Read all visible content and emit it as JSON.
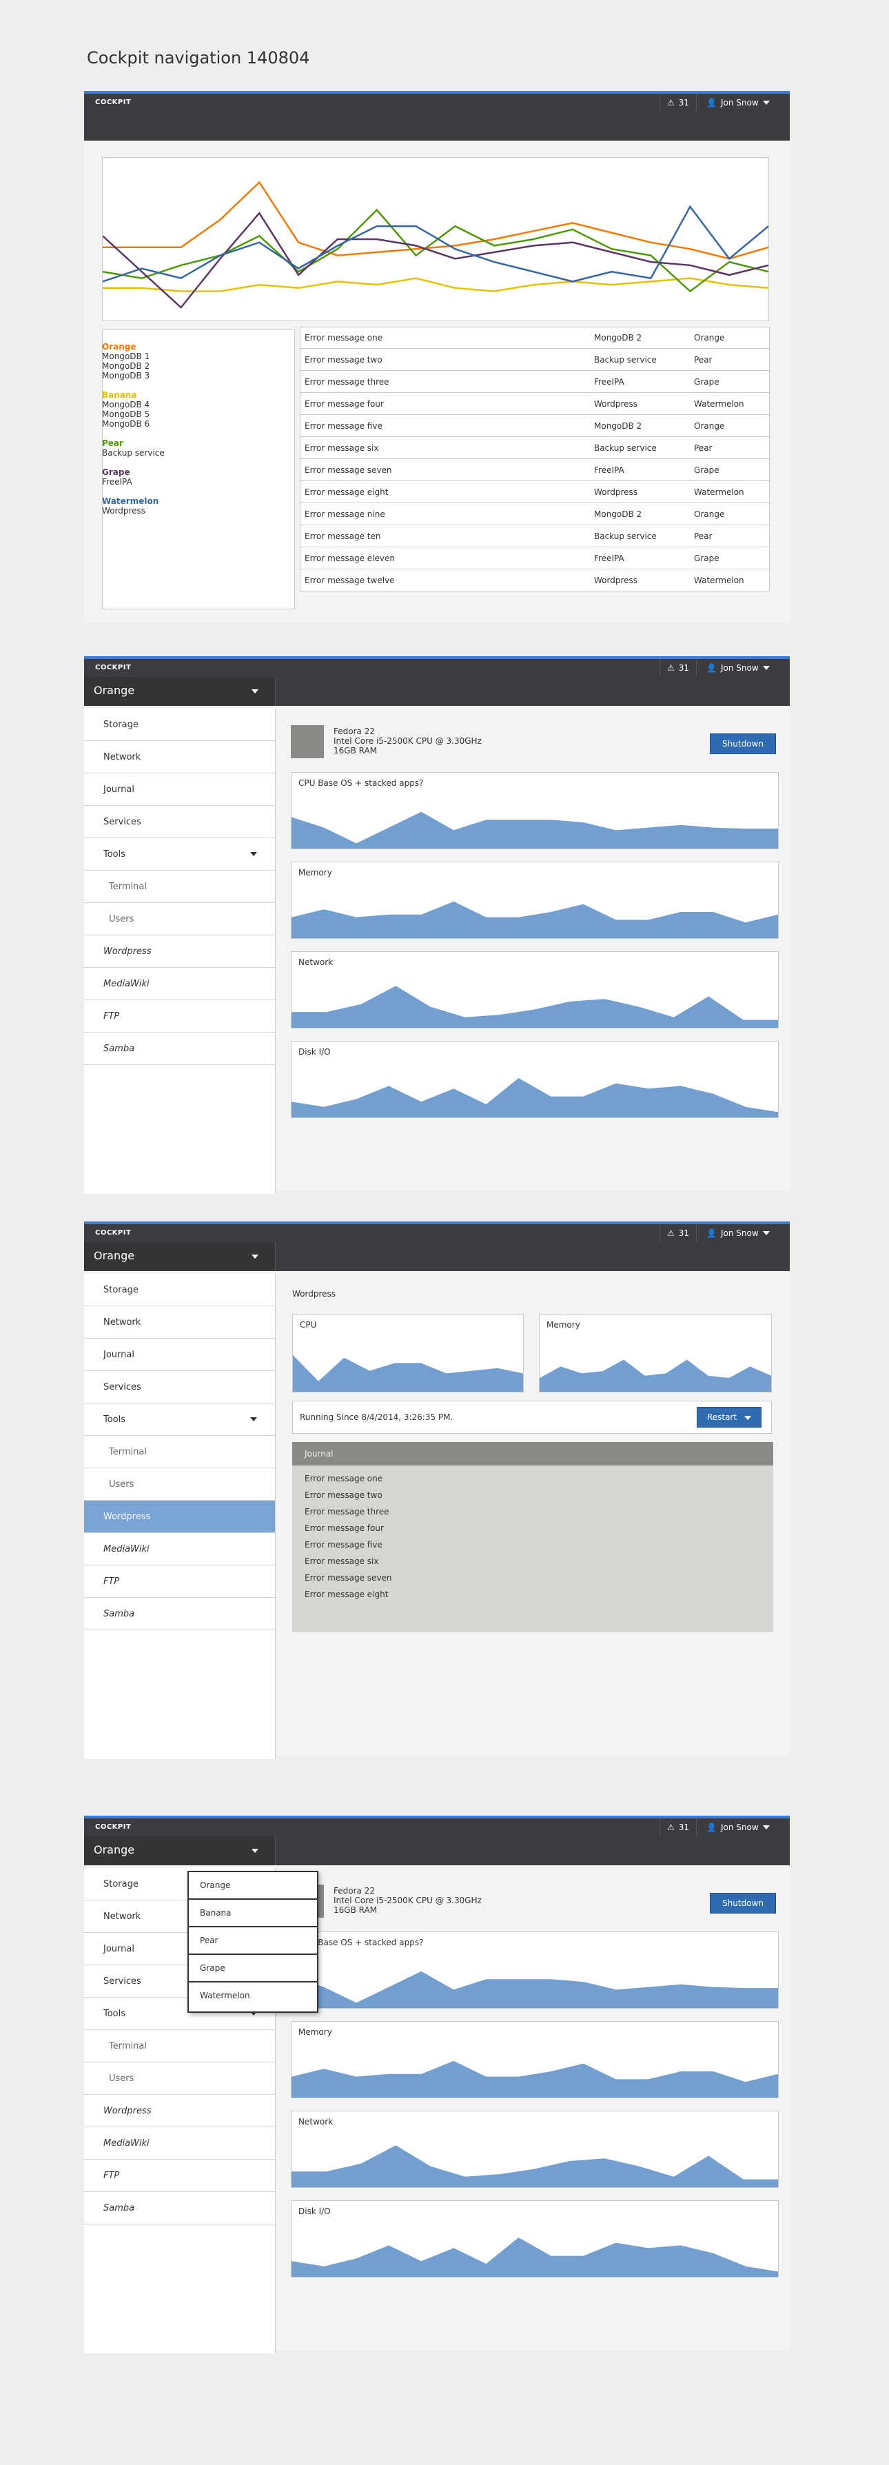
{
  "page_title": "Cockpit navigation 140804",
  "topbar": {
    "brand": "COCKPIT",
    "alert_count": "31",
    "user": "Jon Snow"
  },
  "colors": {
    "orange": "#f57900",
    "banana": "#e5c100",
    "pear": "#4e9a06",
    "grape": "#5c3566",
    "watermelon": "#3465a4",
    "accent": "#2e6bb0",
    "area_fill": "#729fcf"
  },
  "legend": [
    {
      "name": "Orange",
      "color": "#f57900",
      "items": [
        "MongoDB 1",
        "MongoDB 2",
        "MongoDB 3"
      ]
    },
    {
      "name": "Banana",
      "color": "#e5c100",
      "items": [
        "MongoDB 4",
        "MongoDB 5",
        "MongoDB 6"
      ]
    },
    {
      "name": "Pear",
      "color": "#4e9a06",
      "items": [
        "Backup service"
      ]
    },
    {
      "name": "Grape",
      "color": "#5c3566",
      "items": [
        "FreeIPA"
      ]
    },
    {
      "name": "Watermelon",
      "color": "#3465a4",
      "items": [
        "Wordpress"
      ]
    }
  ],
  "errors": [
    [
      "Error message one",
      "MongoDB 2",
      "Orange"
    ],
    [
      "Error message two",
      "Backup service",
      "Pear"
    ],
    [
      "Error message three",
      "FreeIPA",
      "Grape"
    ],
    [
      "Error message four",
      "Wordpress",
      "Watermelon"
    ],
    [
      "Error message five",
      "MongoDB 2",
      "Orange"
    ],
    [
      "Error message six",
      "Backup service",
      "Pear"
    ],
    [
      "Error message seven",
      "FreeIPA",
      "Grape"
    ],
    [
      "Error message eight",
      "Wordpress",
      "Watermelon"
    ],
    [
      "Error message nine",
      "MongoDB 2",
      "Orange"
    ],
    [
      "Error message ten",
      "Backup service",
      "Pear"
    ],
    [
      "Error message eleven",
      "FreeIPA",
      "Grape"
    ],
    [
      "Error message twelve",
      "Wordpress",
      "Watermelon"
    ]
  ],
  "machine": "Orange",
  "nav": [
    "Storage",
    "Network",
    "Journal",
    "Services",
    "Tools",
    "Terminal",
    "Users",
    "Wordpress",
    "MediaWiki",
    "FTP",
    "Samba"
  ],
  "host": {
    "os": "Fedora 22",
    "cpu": "Intel Core i5-2500K CPU @ 3.30GHz",
    "ram": "16GB RAM",
    "shutdown": "Shutdown"
  },
  "charts": {
    "cpu": "CPU Base OS + stacked apps?",
    "memory": "Memory",
    "network": "Network",
    "disk": "Disk I/O"
  },
  "wordpress": {
    "title": "Wordpress",
    "cpu": "CPU",
    "memory": "Memory",
    "running": "Running Since 8/4/2014, 3:26:35 PM.",
    "restart": "Restart",
    "journal_title": "Journal",
    "journal": [
      "Error message one",
      "Error message two",
      "Error message three",
      "Error message four",
      "Error message five",
      "Error message six",
      "Error message seven",
      "Error message eight"
    ]
  },
  "dropdown": [
    "Orange",
    "Banana",
    "Pear",
    "Grape",
    "Watermelon"
  ],
  "chart_data": {
    "type": "line",
    "series": [
      {
        "name": "Orange",
        "values": [
          45,
          45,
          45,
          62,
          85,
          48,
          40,
          42,
          44,
          46,
          50,
          55,
          60,
          54,
          48,
          44,
          38,
          45
        ]
      },
      {
        "name": "Banana",
        "values": [
          20,
          20,
          18,
          18,
          22,
          20,
          24,
          22,
          26,
          20,
          18,
          22,
          24,
          22,
          24,
          26,
          22,
          20
        ]
      },
      {
        "name": "Pear",
        "values": [
          30,
          26,
          34,
          40,
          52,
          30,
          44,
          68,
          40,
          58,
          46,
          50,
          56,
          44,
          40,
          18,
          36,
          30
        ]
      },
      {
        "name": "Grape",
        "values": [
          52,
          30,
          8,
          38,
          66,
          28,
          50,
          50,
          46,
          38,
          42,
          46,
          48,
          42,
          36,
          34,
          28,
          34
        ]
      },
      {
        "name": "Watermelon",
        "values": [
          24,
          32,
          26,
          40,
          48,
          32,
          46,
          58,
          58,
          44,
          36,
          30,
          24,
          30,
          26,
          70,
          38,
          58
        ]
      }
    ],
    "ylim": [
      0,
      100
    ]
  }
}
